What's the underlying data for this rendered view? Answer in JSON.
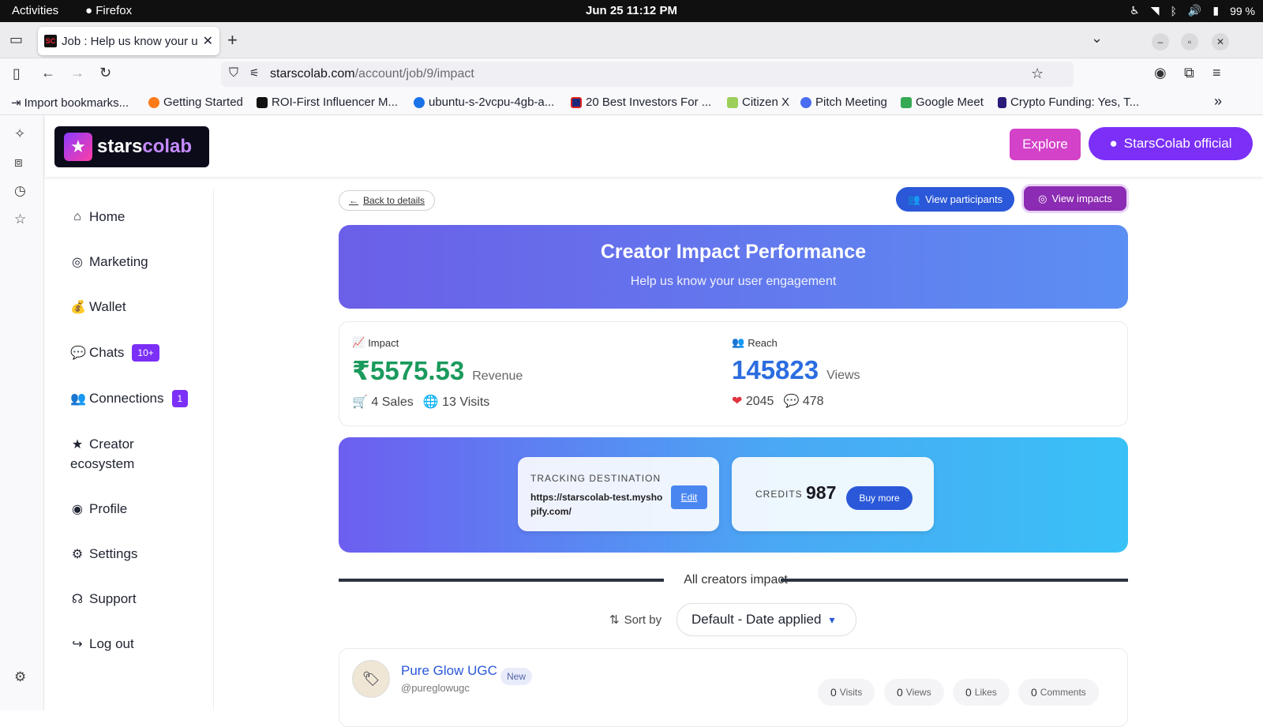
{
  "os": {
    "activities": "Activities",
    "app": "Firefox",
    "clock": "Jun 25  11:12 PM",
    "battery": "99 %"
  },
  "browser": {
    "tab_title": "Job : Help us know your u",
    "tab_favicon": "SC",
    "url_host": "starscolab.com",
    "url_path": "/account/job/9/impact",
    "bookmarks": [
      "Import bookmarks...",
      "Getting Started",
      "ROI-First Influencer M...",
      "ubuntu-s-2vcpu-4gb-a...",
      "20 Best Investors For ...",
      "Citizen X",
      "Pitch Meeting",
      "Google Meet",
      "Crypto Funding: Yes, T..."
    ]
  },
  "header": {
    "logo_part1": "stars",
    "logo_part2": "colab",
    "explore": "Explore",
    "account": "StarsColab official"
  },
  "sidebar": {
    "items": [
      {
        "label": "Home"
      },
      {
        "label": "Marketing"
      },
      {
        "label": "Wallet"
      },
      {
        "label": "Chats",
        "badge": "10+"
      },
      {
        "label": "Connections",
        "badge": "1"
      },
      {
        "label": "Creator"
      },
      {
        "label": "ecosystem"
      },
      {
        "label": "Profile"
      },
      {
        "label": "Settings"
      },
      {
        "label": "Support"
      },
      {
        "label": "Log out"
      }
    ]
  },
  "main": {
    "back": "Back to details",
    "view_participants": "View participants",
    "view_impacts": "View impacts",
    "hero_title": "Creator Impact Performance",
    "hero_subtitle": "Help us know your user engagement",
    "impact": {
      "label": "Impact",
      "value": "₹5575.53",
      "unit": "Revenue",
      "sales": "4 Sales",
      "visits": "13 Visits"
    },
    "reach": {
      "label": "Reach",
      "value": "145823",
      "unit": "Views",
      "likes": "2045",
      "comments": "478"
    },
    "tracking": {
      "label": "TRACKING DESTINATION",
      "url": "https://starscolab-test.myshopify.com/",
      "edit": "Edit"
    },
    "credits": {
      "label": "CREDITS",
      "value": "987",
      "buy": "Buy more"
    },
    "section_title": "All creators impact",
    "sort_label": "Sort by",
    "sort_value": "Default - Date applied",
    "creator": {
      "name": "Pure Glow UGC",
      "handle": "@pureglowugc",
      "badge": "New",
      "visits": "0",
      "visits_label": "Visits",
      "views": "0",
      "views_label": "Views",
      "likes": "0",
      "likes_label": "Likes",
      "comments": "0",
      "comments_label": "Comments"
    }
  },
  "colors": {
    "accent_purple": "#7b2ff7",
    "explore_pink": "#d342c9",
    "primary_blue": "#2a58d8",
    "revenue_green": "#1a9a5c",
    "reach_blue": "#2b6de0"
  }
}
